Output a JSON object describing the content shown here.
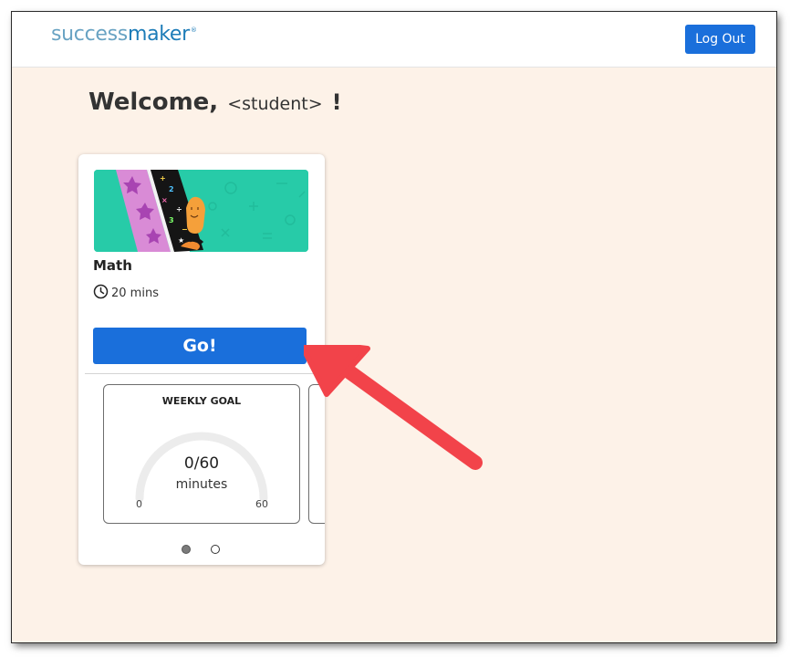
{
  "header": {
    "logo_part1": "success",
    "logo_part2": "maker",
    "logo_mark": "®",
    "logout_label": "Log Out"
  },
  "welcome": {
    "greeting": "Welcome,",
    "name": "<student>",
    "punct": "!"
  },
  "card": {
    "subject": "Math",
    "duration": "20 mins",
    "go_label": "Go!",
    "banner_icon": "math-banner-illustration",
    "clock_icon": "clock-icon"
  },
  "weekly_goal": {
    "title": "WEEKLY GOAL",
    "value_text": "0/60",
    "unit": "minutes",
    "min": "0",
    "max": "60",
    "progress_fraction": 0
  },
  "pagination": {
    "active_index": 0,
    "count": 2
  },
  "colors": {
    "accent_blue": "#1a6fdb",
    "page_background": "#fdf2e8",
    "logo_light": "#69a3c3",
    "logo_dark": "#1d7cb8",
    "annotation_arrow": "#f2434a"
  }
}
